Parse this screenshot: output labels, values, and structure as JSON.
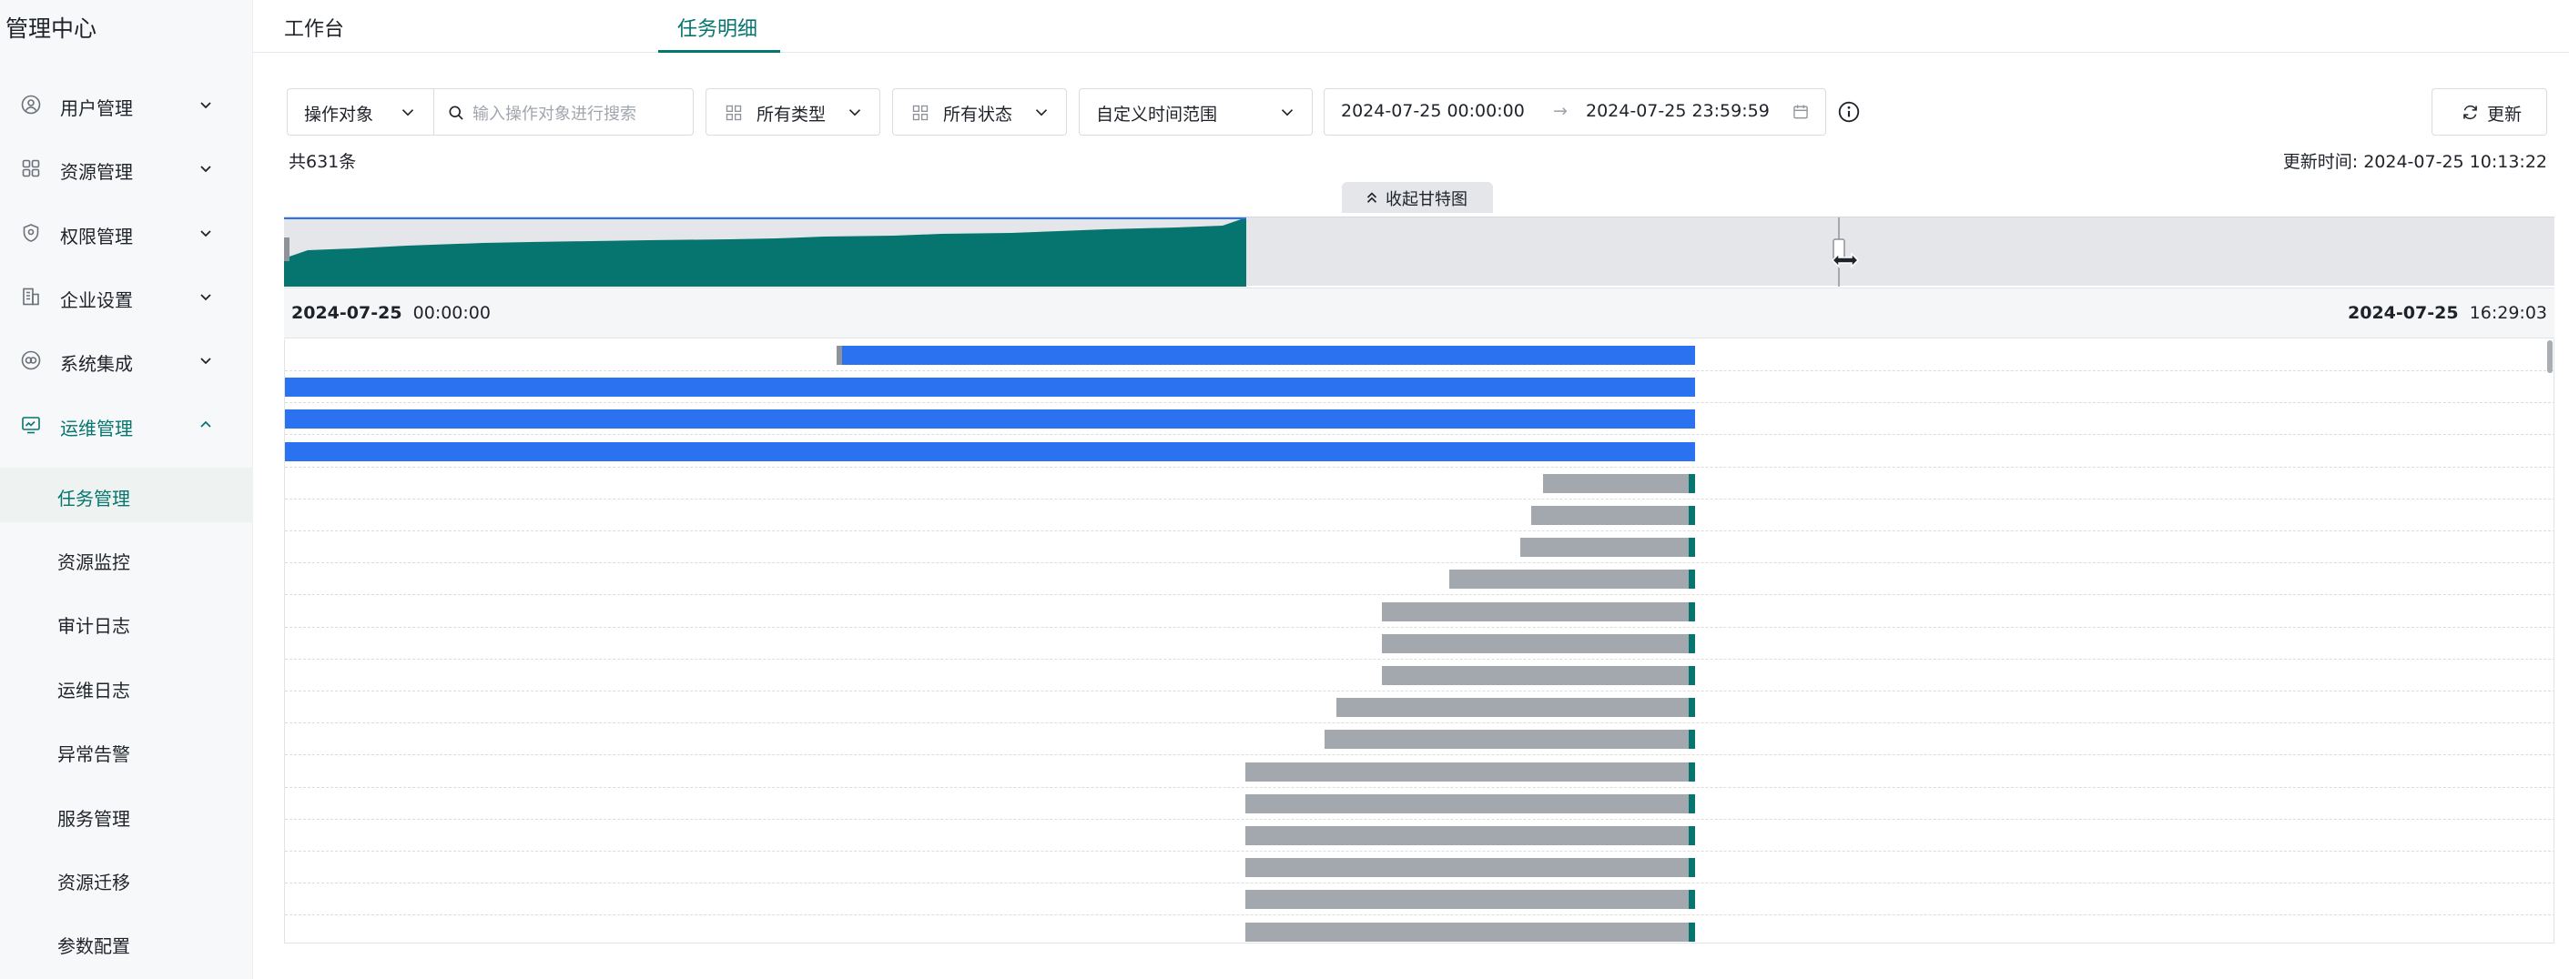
{
  "sidebar": {
    "title": "管理中心",
    "groups": [
      {
        "label": "用户管理",
        "icon": "user-icon"
      },
      {
        "label": "资源管理",
        "icon": "grid-icon"
      },
      {
        "label": "权限管理",
        "icon": "shield-icon"
      },
      {
        "label": "企业设置",
        "icon": "building-icon"
      },
      {
        "label": "系统集成",
        "icon": "integration-icon"
      },
      {
        "label": "运维管理",
        "icon": "monitor-icon"
      }
    ],
    "sub_items": [
      {
        "label": "任务管理"
      },
      {
        "label": "资源监控"
      },
      {
        "label": "审计日志"
      },
      {
        "label": "运维日志"
      },
      {
        "label": "异常告警"
      },
      {
        "label": "服务管理"
      },
      {
        "label": "资源迁移"
      },
      {
        "label": "参数配置"
      }
    ],
    "active_group": "运维管理",
    "active_sub": "任务管理"
  },
  "tabs": [
    {
      "label": "工作台"
    },
    {
      "label": "任务明细"
    }
  ],
  "active_tab": "任务明细",
  "filters": {
    "object_select": "操作对象",
    "search_placeholder": "输入操作对象进行搜索",
    "type_select": "所有类型",
    "status_select": "所有状态",
    "time_range_select": "自定义时间范围",
    "start_time": "2024-07-25 00:00:00",
    "range_arrow": "→",
    "end_time": "2024-07-25 23:59:59"
  },
  "refresh_label": "更新",
  "count_text": "共631条",
  "update_time_text": "更新时间: 2024-07-25 10:13:22",
  "gantt": {
    "collapse_label": "收起甘特图",
    "axis_start_date": "2024-07-25",
    "axis_start_time": "00:00:00",
    "axis_end_date": "2024-07-25",
    "axis_end_time": "16:29:03",
    "colors": {
      "running": "#2b72f0",
      "waiting": "#a3a8ae",
      "done": "#07756f",
      "pending_edge": "#8e9399"
    },
    "tasks": [
      {
        "status": "running",
        "start": 0.243,
        "end": 0.621
      },
      {
        "status": "running",
        "start": 0.0,
        "end": 0.621
      },
      {
        "status": "running",
        "start": 0.0,
        "end": 0.621
      },
      {
        "status": "running",
        "start": 0.0,
        "end": 0.621
      },
      {
        "status": "waiting",
        "start": 0.554,
        "end": 0.621
      },
      {
        "status": "waiting",
        "start": 0.549,
        "end": 0.621
      },
      {
        "status": "waiting",
        "start": 0.544,
        "end": 0.621
      },
      {
        "status": "waiting",
        "start": 0.513,
        "end": 0.621
      },
      {
        "status": "waiting",
        "start": 0.483,
        "end": 0.621
      },
      {
        "status": "waiting",
        "start": 0.483,
        "end": 0.621
      },
      {
        "status": "waiting",
        "start": 0.483,
        "end": 0.621
      },
      {
        "status": "waiting",
        "start": 0.463,
        "end": 0.621
      },
      {
        "status": "waiting",
        "start": 0.458,
        "end": 0.621
      },
      {
        "status": "waiting",
        "start": 0.423,
        "end": 0.621
      },
      {
        "status": "waiting",
        "start": 0.423,
        "end": 0.621
      },
      {
        "status": "waiting",
        "start": 0.423,
        "end": 0.621
      },
      {
        "status": "waiting",
        "start": 0.423,
        "end": 0.621
      },
      {
        "status": "waiting",
        "start": 0.423,
        "end": 0.621
      },
      {
        "status": "waiting",
        "start": 0.423,
        "end": 0.621
      }
    ],
    "overview_fill_fraction": 0.424,
    "overview_window_fraction": 0.685
  }
}
